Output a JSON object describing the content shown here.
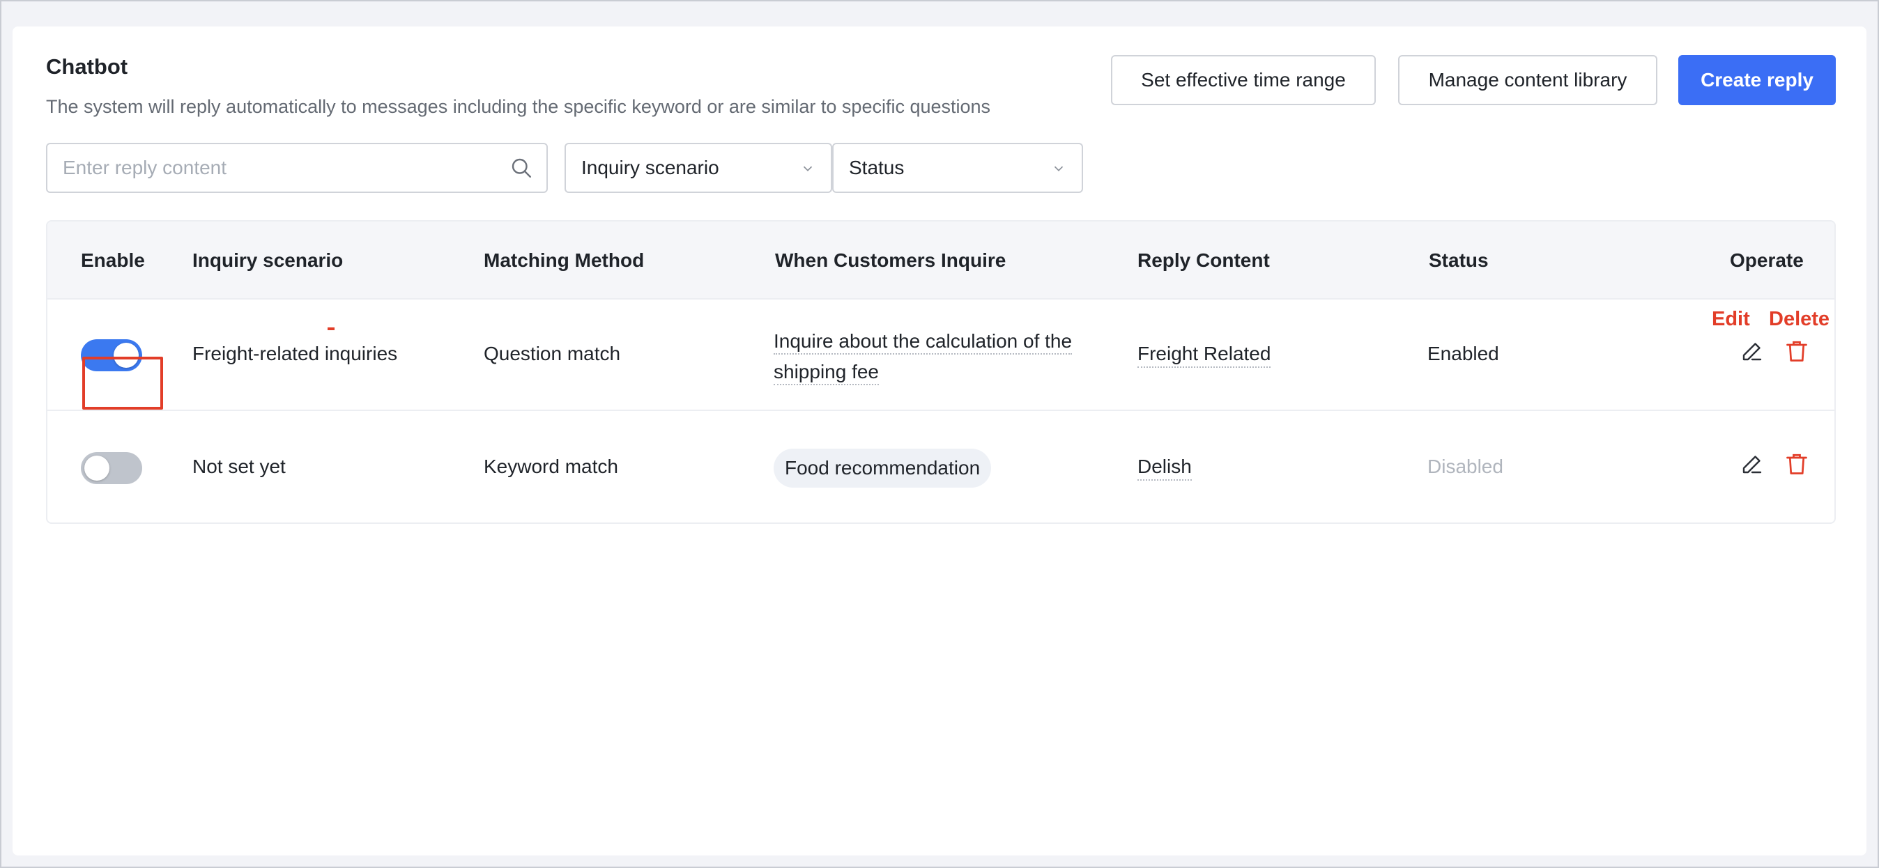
{
  "header": {
    "title": "Chatbot",
    "subtitle": "The system will reply automatically to messages including the specific keyword or are similar to specific questions"
  },
  "toolbar": {
    "set_time_label": "Set effective time range",
    "manage_library_label": "Manage content library",
    "create_reply_label": "Create reply"
  },
  "filters": {
    "search_placeholder": "Enter reply content",
    "search_value": "",
    "scenario_label": "Inquiry scenario",
    "status_label": "Status"
  },
  "table": {
    "columns": [
      "Enable",
      "Inquiry scenario",
      "Matching Method",
      "When Customers Inquire",
      "Reply Content",
      "Status",
      "Operate"
    ],
    "rows": [
      {
        "enabled": true,
        "scenario": "Freight-related inquiries",
        "method": "Question match",
        "inquire_line1": "Inquire about the calculation of the",
        "inquire_line2": "shipping fee",
        "reply": "Freight Related",
        "status": "Enabled"
      },
      {
        "enabled": false,
        "scenario": "Not set yet",
        "method": "Keyword match",
        "inquire_tag": "Food recommendation",
        "reply": "Delish",
        "status": "Disabled"
      }
    ]
  },
  "annotations": {
    "edit": "Edit",
    "delete": "Delete"
  },
  "colors": {
    "primary": "#3b6ef5",
    "danger": "#e23d28",
    "toggle_on": "#3b79f0",
    "toggle_off": "#bfc4cc"
  },
  "icons": {
    "search": "search-icon",
    "chevron": "chevron-down-icon",
    "edit": "edit-icon",
    "delete": "delete-icon"
  }
}
